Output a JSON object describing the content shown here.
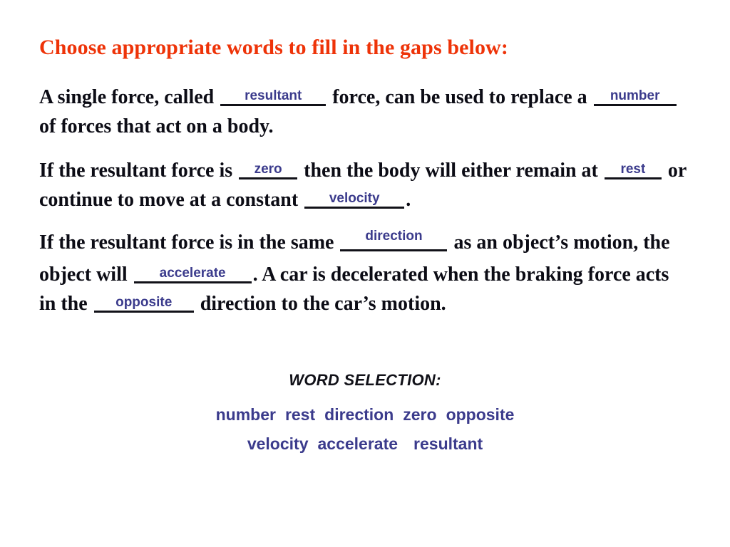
{
  "slide": {
    "title": "Choose appropriate words to fill in the gaps below:",
    "title_color": "#EE3308",
    "body_color": "#0C0C15",
    "answer_color": "#3B3B8C",
    "background": "#FFFFFF"
  },
  "paragraphs": [
    {
      "id": "paragraph-1",
      "segments": [
        {
          "type": "text",
          "value": "A single force, called "
        },
        {
          "type": "blank",
          "value": "resultant",
          "size": "w-resultant"
        },
        {
          "type": "text",
          "value": " force, can be used to replace a "
        },
        {
          "type": "blank",
          "value": "number",
          "size": "w-number"
        },
        {
          "type": "text",
          "value": " of forces that act on a body."
        }
      ]
    },
    {
      "id": "paragraph-2",
      "segments": [
        {
          "type": "text",
          "value": "If the resultant force is "
        },
        {
          "type": "blank",
          "value": "zero",
          "size": "w-zero"
        },
        {
          "type": "text",
          "value": " then the body will either remain at "
        },
        {
          "type": "blank",
          "value": "rest",
          "size": "w-rest"
        },
        {
          "type": "text",
          "value": " or continue to move at a constant "
        },
        {
          "type": "blank",
          "value": "velocity",
          "size": "w-velocity"
        },
        {
          "type": "text",
          "value": "."
        }
      ]
    },
    {
      "id": "paragraph-3",
      "segments": [
        {
          "type": "text",
          "value": "If the resultant force is in the same "
        },
        {
          "type": "blank",
          "value": "direction",
          "size": "w-direction"
        },
        {
          "type": "text",
          "value": " as an object’s motion, the object will "
        },
        {
          "type": "blank",
          "value": "accelerate",
          "size": "w-accelerate"
        },
        {
          "type": "text",
          "value": ". A car is decelerated when the braking force acts in the "
        },
        {
          "type": "blank",
          "value": "opposite",
          "size": "w-opposite"
        },
        {
          "type": "text",
          "value": " direction to the car’s motion."
        }
      ]
    }
  ],
  "word_selection": {
    "heading": "WORD SELECTION:",
    "rows": [
      [
        "number",
        "rest",
        "direction",
        "zero",
        "opposite"
      ],
      [
        "velocity",
        "accelerate",
        "resultant"
      ]
    ],
    "all_words": [
      "number",
      "rest",
      "direction",
      "zero",
      "opposite",
      "velocity",
      "accelerate",
      "resultant"
    ]
  }
}
